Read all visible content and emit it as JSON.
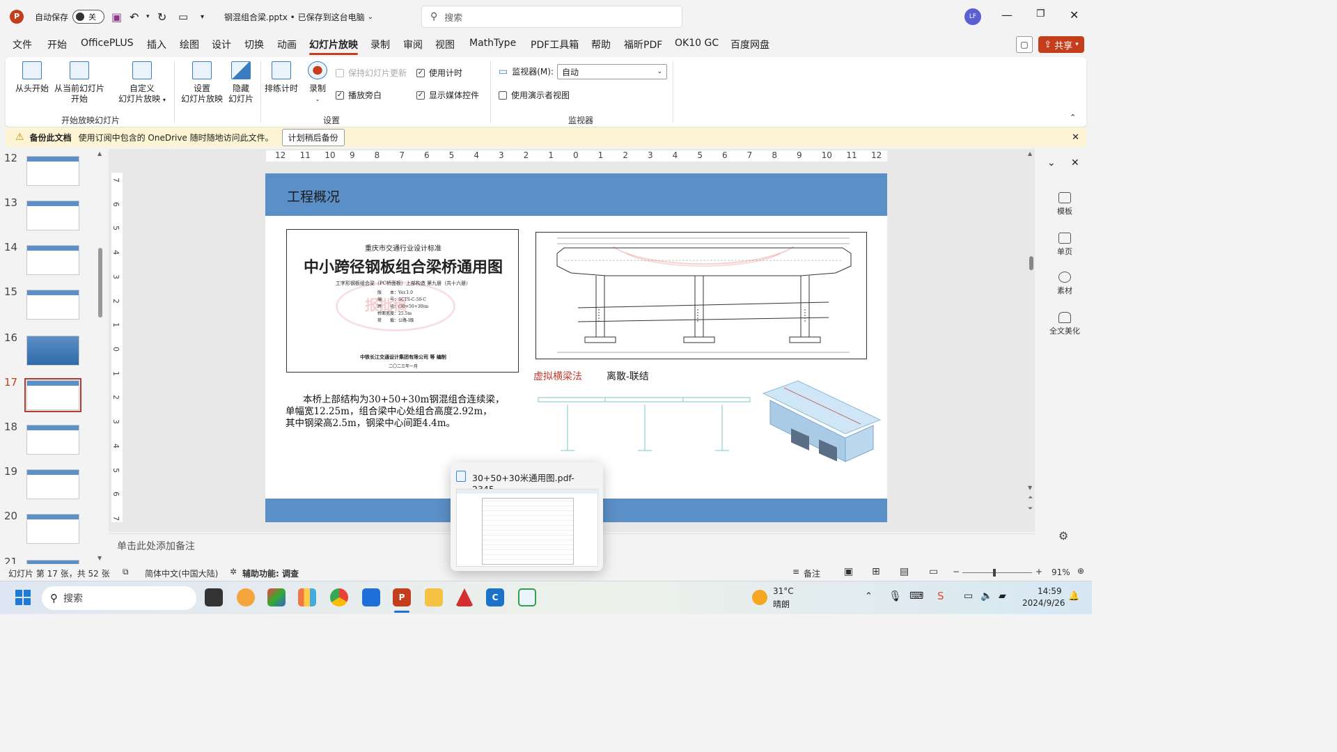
{
  "titlebar": {
    "autosave_label": "自动保存",
    "autosave_state": "关",
    "doc_title": "钢混组合梁.pptx • 已保存到这台电脑",
    "search_placeholder": "搜索",
    "user_initials": "LF"
  },
  "menu": {
    "items": [
      "文件",
      "开始",
      "OfficePLUS",
      "插入",
      "绘图",
      "设计",
      "切换",
      "动画",
      "幻灯片放映",
      "录制",
      "审阅",
      "视图",
      "MathType",
      "PDF工具箱",
      "帮助",
      "福昕PDF",
      "OK10 GC",
      "百度网盘"
    ],
    "active": "幻灯片放映",
    "share_label": "共享"
  },
  "ribbon": {
    "from_start": "从头开始",
    "from_current_1": "从当前幻灯片",
    "from_current_2": "开始",
    "custom_1": "自定义",
    "custom_2": "幻灯片放映",
    "group_start": "开始放映幻灯片",
    "setup_1": "设置",
    "setup_2": "幻灯片放映",
    "hide_1": "隐藏",
    "hide_2": "幻灯片",
    "rehearse": "排练计时",
    "record": "录制",
    "keep_updated": "保持幻灯片更新",
    "use_timings": "使用计时",
    "play_narration": "播放旁白",
    "show_media": "显示媒体控件",
    "group_setup": "设置",
    "monitor_label": "监视器(M):",
    "monitor_value": "自动",
    "presenter_view": "使用演示者视图",
    "group_monitor": "监视器"
  },
  "infobar": {
    "title": "备份此文档",
    "message": "使用订阅中包含的 OneDrive 随时随地访问此文件。",
    "button": "计划稍后备份"
  },
  "ruler": {
    "h_ticks": [
      "12",
      "11",
      "10",
      "9",
      "8",
      "7",
      "6",
      "5",
      "4",
      "3",
      "2",
      "1",
      "0",
      "1",
      "2",
      "3",
      "4",
      "5",
      "6",
      "7",
      "8",
      "9",
      "10",
      "11",
      "12"
    ],
    "v_ticks": [
      "7",
      "6",
      "5",
      "4",
      "3",
      "2",
      "1",
      "0",
      "1",
      "2",
      "3",
      "4",
      "5",
      "6",
      "7"
    ]
  },
  "thumbnails": [
    {
      "num": "12"
    },
    {
      "num": "13"
    },
    {
      "num": "14"
    },
    {
      "num": "15"
    },
    {
      "num": "16"
    },
    {
      "num": "17",
      "current": true
    },
    {
      "num": "18"
    },
    {
      "num": "19"
    },
    {
      "num": "20"
    },
    {
      "num": "21"
    }
  ],
  "slide": {
    "title": "工程概况",
    "cover_publisher": "重庆市交通行业设计标准",
    "cover_title": "中小跨径钢板组合梁桥通用图",
    "cover_subtitle": "工字形钢板组合梁（PC桥面板）上部构造 第九册（共十六册）",
    "cover_stamp": "报批稿",
    "cover_fields": [
      "版　　本：Ver.1.0",
      "编　　号：SCTS-C-50-C",
      "跨　　径：(30+50+30)m",
      "桥面宽度：25.5m",
      "荷　　载：公路-I级"
    ],
    "cover_author": "中铁长江交通设计集团有限公司 等 编制",
    "cover_date": "二〇二三年一月",
    "method_red": "虚拟横梁法",
    "method_black": "离散-联结",
    "desc_line1": "本桥上部结构为30+50+30m钢混组合连续梁，",
    "desc_line2": "单幅宽12.25m，组合梁中心处组合高度2.92m，",
    "desc_line3": "其中钢梁高2.5m，钢梁中心间距4.4m。"
  },
  "notes_placeholder": "单击此处添加备注",
  "statusbar": {
    "slide_info": "幻灯片 第 17 张，共 52 张",
    "language": "简体中文(中国大陆)",
    "accessibility": "辅助功能: 调查",
    "notes": "备注",
    "zoom": "91%"
  },
  "rightpane": {
    "items": [
      "模板",
      "单页",
      "素材",
      "全文美化"
    ]
  },
  "popup": {
    "title": "30+50+30米通用图.pdf-2345..."
  },
  "taskbar": {
    "search": "搜索",
    "weather_temp": "31°C",
    "weather_desc": "晴朗",
    "time": "14:59",
    "date": "2024/9/26"
  },
  "colors": {
    "accent": "#c43e1c",
    "slide_header": "#5b8fc7",
    "red_text": "#c0392b"
  }
}
